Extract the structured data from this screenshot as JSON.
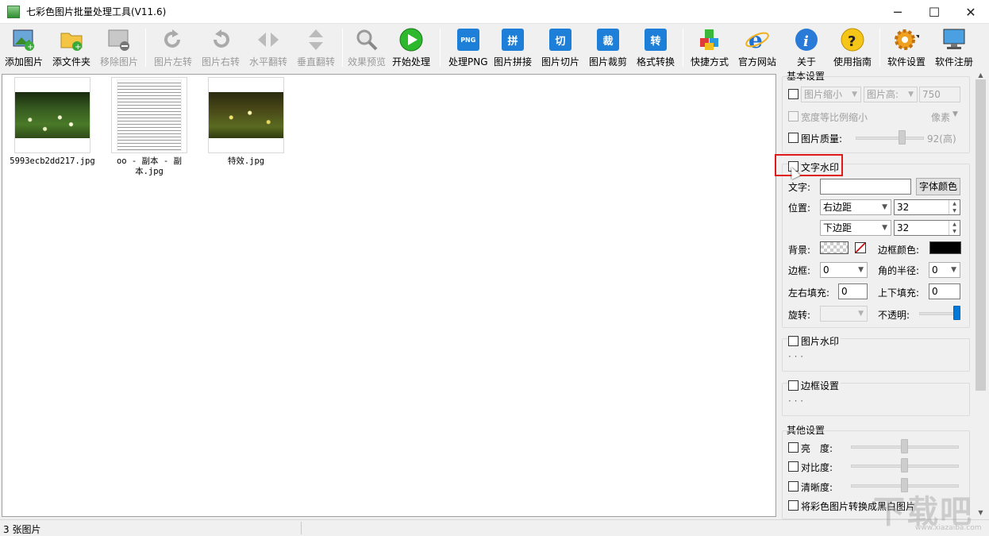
{
  "window": {
    "title": "七彩色图片批量处理工具(V11.6)",
    "minimize": "─",
    "maximize": "☐",
    "close": "✕"
  },
  "toolbar": {
    "add_image": "添加图片",
    "add_folder": "添文件夹",
    "remove_image": "移除图片",
    "rotate_left": "图片左转",
    "rotate_right": "图片右转",
    "flip_h": "水平翻转",
    "flip_v": "垂直翻转",
    "preview": "效果预览",
    "start": "开始处理",
    "png": "处理PNG",
    "png_icon": "PNG",
    "stitch": "图片拼接",
    "stitch_icon": "拼",
    "slice": "图片切片",
    "slice_icon": "切",
    "crop": "图片裁剪",
    "crop_icon": "裁",
    "convert": "格式转换",
    "convert_icon": "转",
    "shortcut": "快捷方式",
    "website": "官方网站",
    "about": "关于",
    "guide": "使用指南",
    "settings": "软件设置",
    "register": "软件注册"
  },
  "files": [
    {
      "name": "5993ecb2dd217.jpg"
    },
    {
      "name": "oo - 副本 - 副本.jpg"
    },
    {
      "name": "特效.jpg"
    }
  ],
  "panel": {
    "basic_title": "基本设置",
    "resize_label": "图片缩小",
    "height_label": "图片高:",
    "height_value": "750",
    "proportional_label": "宽度等比例缩小",
    "unit_value": "像素",
    "quality_label": "图片质量:",
    "quality_value": "92(高)",
    "text_wm_label": "文字水印",
    "text_label": "文字:",
    "text_value": "",
    "font_color_btn": "字体颜色",
    "position_label": "位置:",
    "pos_h_value": "右边距",
    "pos_h_num": "32",
    "pos_v_value": "下边距",
    "pos_v_num": "32",
    "bg_label": "背景:",
    "border_color_label": "边框颜色:",
    "border_label": "边框:",
    "border_value": "0",
    "radius_label": "角的半径:",
    "radius_value": "0",
    "lr_pad_label": "左右填充:",
    "lr_pad_value": "0",
    "tb_pad_label": "上下填充:",
    "tb_pad_value": "0",
    "rotate_label": "旋转:",
    "rotate_value": "",
    "opacity_label": "不透明:",
    "img_wm_label": "图片水印",
    "img_wm_dots": "· · ·",
    "frame_label": "边框设置",
    "frame_dots": "· · ·",
    "other_title": "其他设置",
    "brightness_label": "亮　度:",
    "contrast_label": "对比度:",
    "sharpness_label": "清晰度:",
    "grayscale_label": "将彩色图片转换成黑白图片"
  },
  "status": {
    "count": "3 张图片"
  },
  "watermark": {
    "text": "下载吧",
    "url": "www.xiazaiba.com"
  },
  "colors": {
    "accent_blue": "#1e7fd8",
    "highlight_red": "#e0191b"
  }
}
